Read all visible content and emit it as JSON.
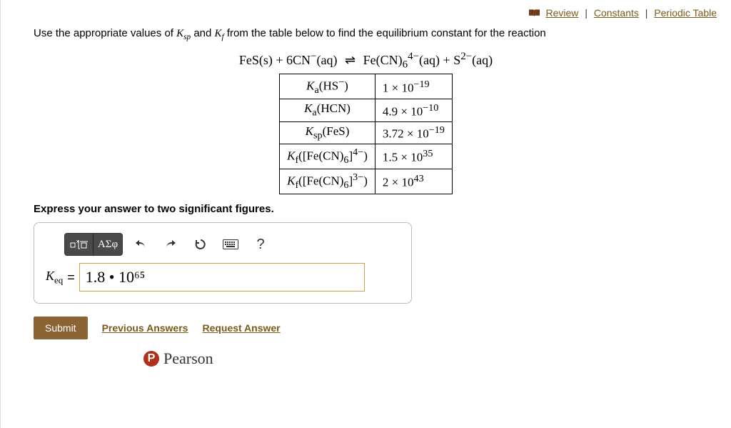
{
  "topLinks": {
    "review": "Review",
    "constants": "Constants",
    "periodic": "Periodic Table"
  },
  "prompt": {
    "before": "Use the appropriate values of ",
    "ksp": "K",
    "kspSub": "sp",
    "and": " and ",
    "kf": "K",
    "kfSub": "f",
    "after": "  from the table below to find the equilibrium constant for the reaction"
  },
  "equation": {
    "lhs1": "FeS(s)",
    "plus": " + ",
    "lhs2a": "6CN",
    "lhs2sup": "−",
    "lhs2b": "(aq)",
    "arrow": "⇌",
    "rhs1a": "Fe(CN)",
    "rhs1sub": "6",
    "rhs1sup": "4−",
    "rhs1b": "(aq)",
    "rhs2a": "S",
    "rhs2sup": "2−",
    "rhs2b": "(aq)"
  },
  "table": [
    {
      "labelHtml": "<i>K</i><sub>a</sub>(HS<sup>−</sup>)",
      "value": "1 × 10<sup>−19</sup>"
    },
    {
      "labelHtml": "<i>K</i><sub>a</sub>(HCN)",
      "value": "4.9 × 10<sup>−10</sup>"
    },
    {
      "labelHtml": "<i>K</i><sub>sp</sub>(FeS)",
      "value": "3.72 × 10<sup>−19</sup>"
    },
    {
      "labelHtml": "<i>K</i><sub>f</sub>([Fe(CN)<sub>6</sub>]<sup>4−</sup>)",
      "value": "1.5 × 10<sup>35</sup>"
    },
    {
      "labelHtml": "<i>K</i><sub>f</sub>([Fe(CN)<sub>6</sub>]<sup>3−</sup>)",
      "value": "2 × 10<sup>43</sup>"
    }
  ],
  "instruction": "Express your answer to two significant figures.",
  "toolbar": {
    "greek": "ΑΣφ",
    "help": "?"
  },
  "answer": {
    "label": "K",
    "labelSub": "eq",
    "equals": "=",
    "value": "1.8 • 10⁶⁵"
  },
  "buttons": {
    "submit": "Submit",
    "prev": "Previous Answers",
    "request": "Request Answer"
  },
  "footer": {
    "brand": "Pearson",
    "brandLetter": "P"
  }
}
